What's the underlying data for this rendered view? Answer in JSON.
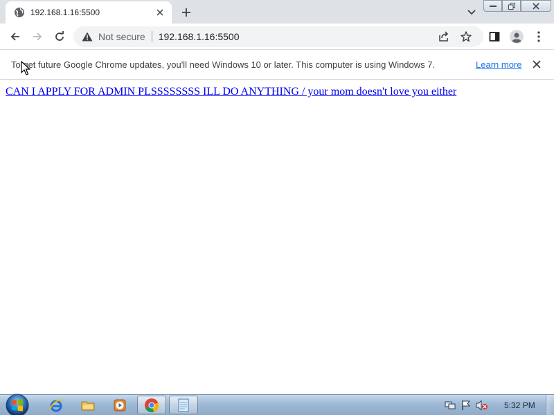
{
  "browser": {
    "tab": {
      "title": "192.168.1.16:5500"
    },
    "icons": {
      "favicon": "globe-icon",
      "tab_close": "close-icon",
      "new_tab": "plus-icon",
      "tab_search": "chevron-down-icon"
    },
    "toolbar": {
      "security_label": "Not secure",
      "url": "192.168.1.16:5500"
    },
    "infobar": {
      "message": "To get future Google Chrome updates, you'll need Windows 10 or later. This computer is using Windows 7.",
      "link": "Learn more"
    }
  },
  "page": {
    "link_text": "CAN I APPLY FOR ADMIN PLSSSSSSSS ILL DO ANYTHING / your mom doesn't love you either"
  },
  "taskbar": {
    "clock": "5:32 PM"
  },
  "colors": {
    "tabstrip": "#dee1e6",
    "omnibox": "#f1f3f4",
    "link": "#0000ee",
    "learn_more": "#1a73e8"
  }
}
